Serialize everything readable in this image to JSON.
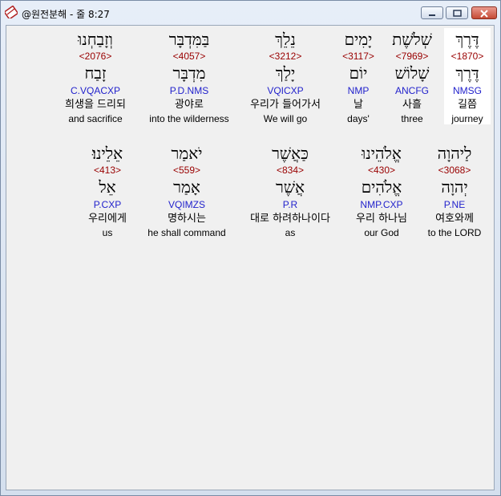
{
  "window": {
    "title": "@원전분해 - 줄 8:27"
  },
  "icons": {
    "app": "app-icon",
    "minimize": "minimize-icon",
    "maximize": "maximize-icon",
    "close": "close-icon"
  },
  "rows": [
    {
      "words": [
        {
          "hebrew": "דֶּרֶךְ",
          "strong": "<1870>",
          "lemma": "דֶּרֶךְ",
          "parse": "NMSG",
          "korean": "길쯤",
          "english": "journey"
        },
        {
          "hebrew": "שְׁלֹשֶׁת",
          "strong": "<7969>",
          "lemma": "שָׁלוֹשׁ",
          "parse": "ANCFG",
          "korean": "사흘",
          "english": "three"
        },
        {
          "hebrew": "יָמִים",
          "strong": "<3117>",
          "lemma": "יוֹם",
          "parse": "NMP",
          "korean": "날",
          "english": "days'"
        },
        {
          "hebrew": "נֵלֵךְ",
          "strong": "<3212>",
          "lemma": "יָלַךְ",
          "parse": "VQICXP",
          "korean": "우리가 들어가서",
          "english": "We will go"
        },
        {
          "hebrew": "בַּמִּדְבָּר",
          "strong": "<4057>",
          "lemma": "מִדְבָּר",
          "parse": "P.D.NMS",
          "korean": "광야로",
          "english": "into the wilderness"
        },
        {
          "hebrew": "וְזָבַחְנוּ",
          "strong": "<2076>",
          "lemma": "זָבַח",
          "parse": "C.VQACXP",
          "korean": "희생을 드리되",
          "english": "and sacrifice"
        }
      ]
    },
    {
      "words": [
        {
          "hebrew": "לַיהוָה",
          "strong": "<3068>",
          "lemma": "יְהוָה",
          "parse": "P.NE",
          "korean": "여호와께",
          "english": "to the LORD"
        },
        {
          "hebrew": "אֱלֹהֵינוּ",
          "strong": "<430>",
          "lemma": "אֱלֹהִים",
          "parse": "NMP.CXP",
          "korean": "우리 하나님",
          "english": "our God"
        },
        {
          "hebrew": "כַּאֲשֶׁר",
          "strong": "<834>",
          "lemma": "אֲשֶׁר",
          "parse": "P.R",
          "korean": "대로 하려하나이다",
          "english": "as"
        },
        {
          "hebrew": "יֹאמַר",
          "strong": "<559>",
          "lemma": "אָמַר",
          "parse": "VQIMZS",
          "korean": "명하시는",
          "english": "he shall command"
        },
        {
          "hebrew": "אֵלֵינוּ׃",
          "strong": "<413>",
          "lemma": "אֵל",
          "parse": "P.CXP",
          "korean": "우리에게",
          "english": "us"
        }
      ]
    }
  ]
}
